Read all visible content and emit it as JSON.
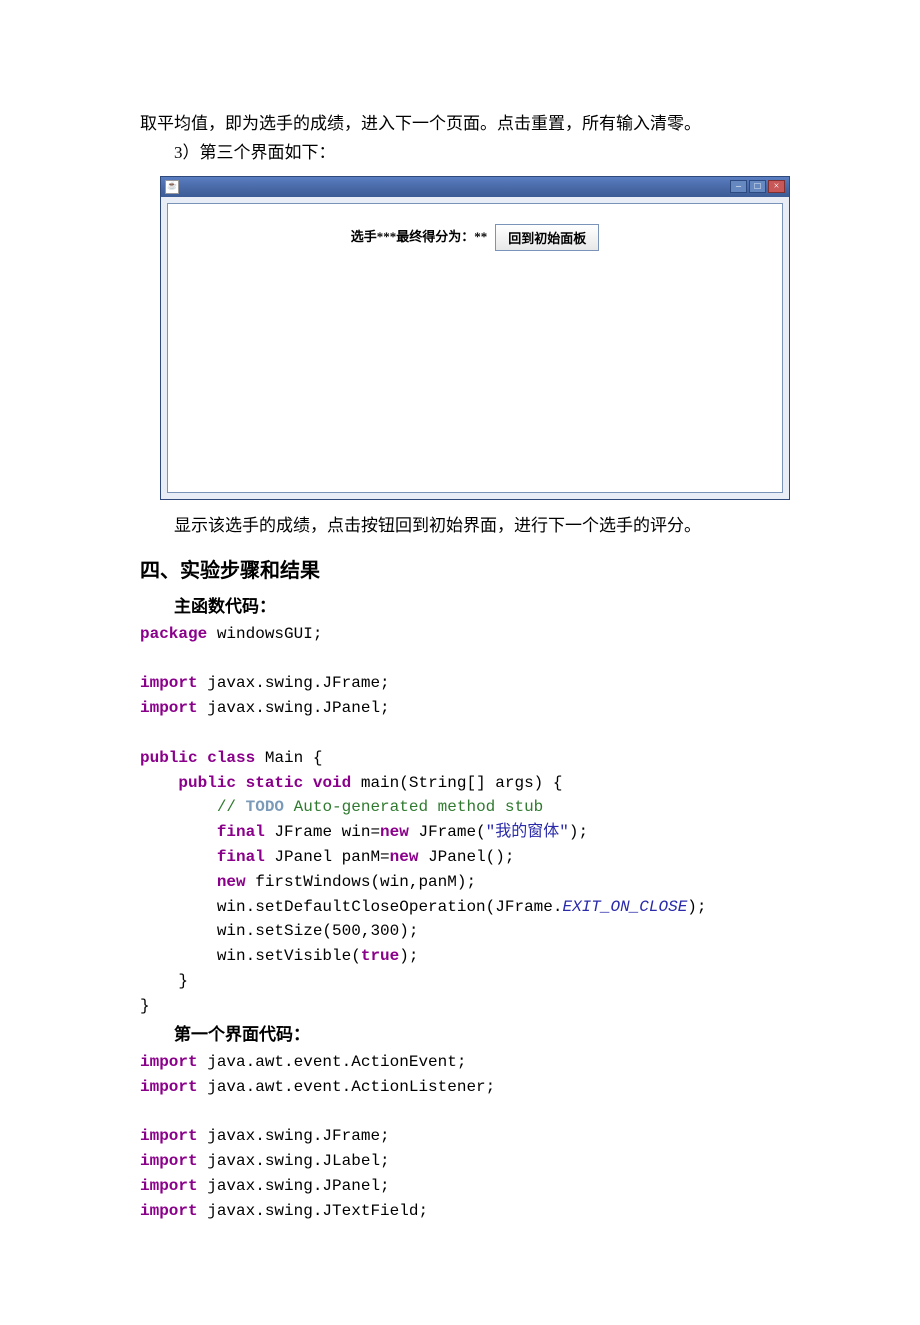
{
  "para1": "取平均值，即为选手的成绩，进入下一个页面。点击重置，所有输入清零。",
  "para2": "3）第三个界面如下：",
  "window": {
    "score_label": "选手***最终得分为：**",
    "back_button": "回到初始面板"
  },
  "caption": "显示该选手的成绩，点击按钮回到初始界面，进行下一个选手的评分。",
  "section_heading": "四、实验步骤和结果",
  "subhead1": "主函数代码：",
  "code1": {
    "l1_kw": "package",
    "l1_r": " windowsGUI;",
    "l2_kw": "import",
    "l2_r": " javax.swing.JFrame;",
    "l3_kw": "import",
    "l3_r": " javax.swing.JPanel;",
    "l4_kw1": "public",
    "l4_kw2": "class",
    "l4_r": " Main {",
    "l5_kw1": "public",
    "l5_kw2": "static",
    "l5_kw3": "void",
    "l5_r": " main(String[] args) {",
    "l6_c1": "// ",
    "l6_todo": "TODO",
    "l6_c2": " Auto-generated method stub",
    "l7_kw1": "final",
    "l7_a": " JFrame win=",
    "l7_kw2": "new",
    "l7_b": " JFrame(",
    "l7_str": "\"我的窗体\"",
    "l7_c": ");",
    "l8_kw1": "final",
    "l8_a": " JPanel panM=",
    "l8_kw2": "new",
    "l8_b": " JPanel();",
    "l9_kw": "new",
    "l9_r": " firstWindows(win,panM);",
    "l10_a": "win.setDefaultCloseOperation(JFrame.",
    "l10_const": "EXIT_ON_CLOSE",
    "l10_b": ");",
    "l11": "win.setSize(500,300);",
    "l12_a": "win.setVisible(",
    "l12_kw": "true",
    "l12_b": ");",
    "l13": "    }",
    "l14": "}"
  },
  "subhead2": "第一个界面代码：",
  "code2": {
    "l1_kw": "import",
    "l1_r": " java.awt.event.ActionEvent;",
    "l2_kw": "import",
    "l2_r": " java.awt.event.ActionListener;",
    "l3_kw": "import",
    "l3_r": " javax.swing.JFrame;",
    "l4_kw": "import",
    "l4_r": " javax.swing.JLabel;",
    "l5_kw": "import",
    "l5_r": " javax.swing.JPanel;",
    "l6_kw": "import",
    "l6_r": " javax.swing.JTextField;"
  }
}
